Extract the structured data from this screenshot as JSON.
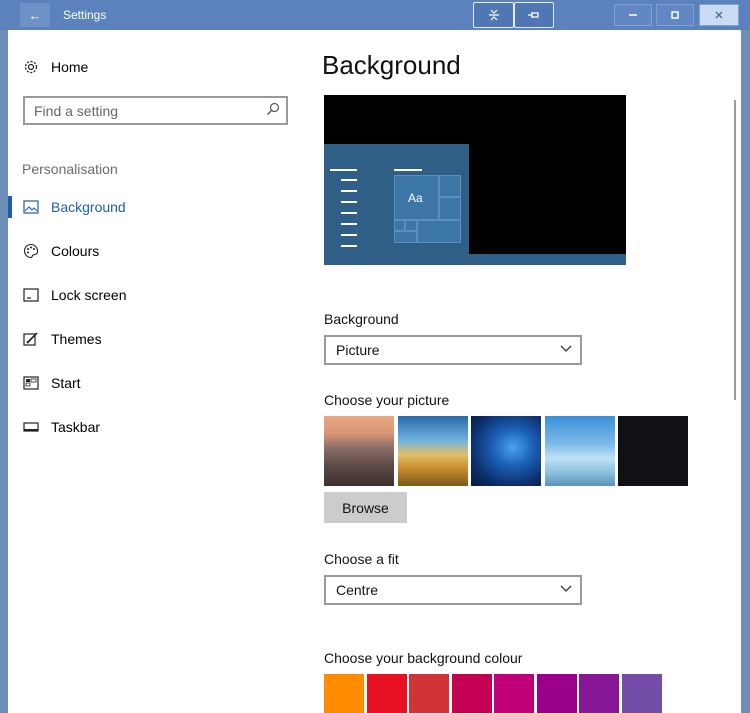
{
  "window": {
    "title": "Settings",
    "back_icon": "arrow-left-icon",
    "tools": [
      "collapse-icon",
      "pin-icon"
    ],
    "controls": {
      "minimize": "minimize-icon",
      "maximize": "maximize-icon",
      "close": "close-icon"
    }
  },
  "nav": {
    "home_label": "Home",
    "home_icon": "gear-icon",
    "search": {
      "placeholder": "Find a setting",
      "icon": "search-icon"
    },
    "section_title": "Personalisation",
    "items": [
      {
        "label": "Background",
        "icon": "picture-icon",
        "active": true
      },
      {
        "label": "Colours",
        "icon": "palette-icon",
        "active": false
      },
      {
        "label": "Lock screen",
        "icon": "lock-screen-icon",
        "active": false
      },
      {
        "label": "Themes",
        "icon": "brush-icon",
        "active": false
      },
      {
        "label": "Start",
        "icon": "start-menu-icon",
        "active": false
      },
      {
        "label": "Taskbar",
        "icon": "taskbar-icon",
        "active": false
      }
    ]
  },
  "main": {
    "title": "Background",
    "preview": {
      "sample_text": "Aa"
    },
    "background_label": "Background",
    "background_value": "Picture",
    "picture_label": "Choose your picture",
    "pictures": [
      "beach-sunset-thumbnail",
      "sand-dunes-thumbnail",
      "windows-light-thumbnail",
      "beach-person-thumbnail",
      "dark-night-thumbnail"
    ],
    "browse_label": "Browse",
    "fit_label": "Choose a fit",
    "fit_value": "Centre",
    "colour_label": "Choose your background colour",
    "colours": [
      "#ff8c00",
      "#e81123",
      "#d13438",
      "#c30052",
      "#bf0077",
      "#9a0089",
      "#881798",
      "#744da9"
    ]
  },
  "accent": "#1d5fa8",
  "titlebar_color": "#5b82bd"
}
